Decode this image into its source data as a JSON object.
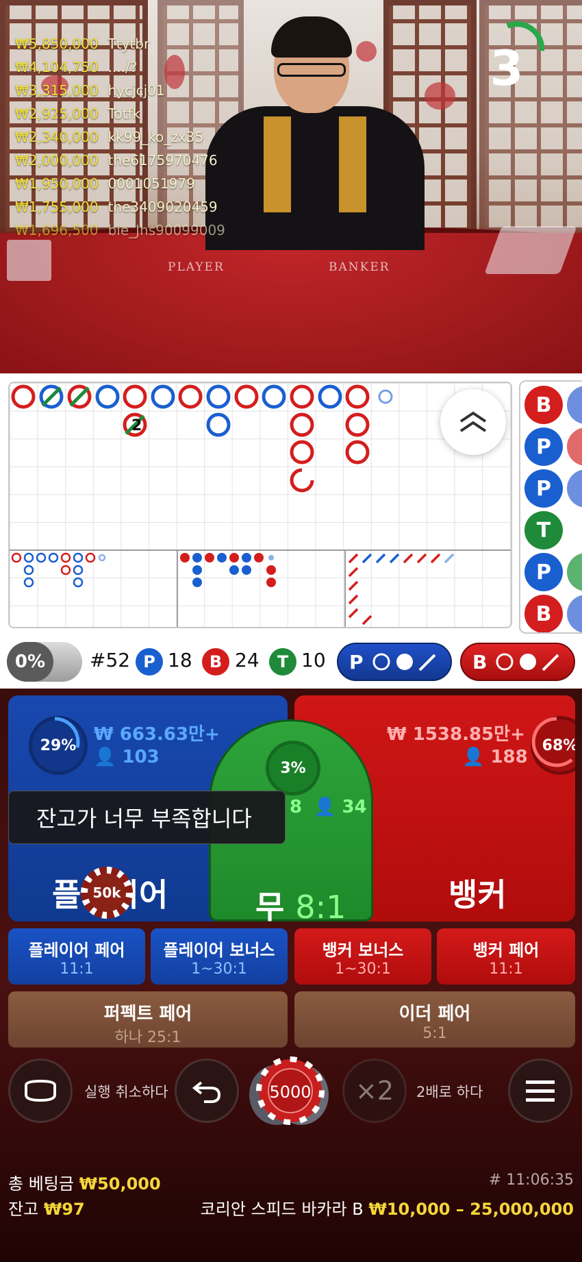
{
  "leaderboard": [
    {
      "amount": "₩5,850,000",
      "user": "Ttytbr"
    },
    {
      "amount": "₩4,104,750",
      "user": "..../?"
    },
    {
      "amount": "₩3,315,000",
      "user": "hycjcj01"
    },
    {
      "amount": "₩2,925,000",
      "user": "Totfk"
    },
    {
      "amount": "₩2,340,000",
      "user": "kk99_ko_zx35"
    },
    {
      "amount": "₩2,000,000",
      "user": "the6175970476"
    },
    {
      "amount": "₩1,950,000",
      "user": "0001051979"
    },
    {
      "amount": "₩1,755,000",
      "user": "the3409020459"
    },
    {
      "amount": "₩1,696,500",
      "user": "bie_Jhs90099009"
    }
  ],
  "timer": {
    "seconds": "3"
  },
  "table_labels": {
    "player": "PLAYER",
    "banker": "BANKER"
  },
  "roadmap": {
    "tie_badge": "2",
    "bead_labels": [
      "B",
      "P",
      "P",
      "T",
      "P",
      "B"
    ]
  },
  "stats": {
    "percent": "0%",
    "round": "#52",
    "player_label": "P",
    "player_count": "18",
    "banker_label": "B",
    "banker_count": "24",
    "tie_label": "T",
    "tie_count": "10",
    "player_predict": "P",
    "banker_predict": "B"
  },
  "colors": {
    "player": "#1a5fd0",
    "banker": "#d41e1e",
    "tie": "#1e8a3a",
    "gold": "#f4d63a"
  },
  "bets": {
    "player": {
      "percent": "29%",
      "amount": "₩ 663.63만+",
      "players": "103",
      "title": "플레이어"
    },
    "tie": {
      "percent": "3%",
      "amount_partial": "8",
      "players": "34",
      "title": "무",
      "odds": "8:1"
    },
    "banker": {
      "percent": "68%",
      "amount": "₩ 1538.85만+",
      "players": "188",
      "title": "뱅커"
    }
  },
  "toast": "잔고가 너무 부족합니다",
  "placed_chip": "50k",
  "side_bets": [
    {
      "title": "플레이어 페어",
      "odds": "11:1"
    },
    {
      "title": "플레이어 보너스",
      "odds": "1~30:1"
    },
    {
      "title": "뱅커 보너스",
      "odds": "1~30:1"
    },
    {
      "title": "뱅커 페어",
      "odds": "11:1"
    }
  ],
  "pair_bets": [
    {
      "title": "퍼펙트 페어",
      "odds": "하나 25:1"
    },
    {
      "title": "이더 페어",
      "odds": "5:1"
    }
  ],
  "controls": {
    "undo_label": "실행 취소하다",
    "chip_value": "5000",
    "double_symbol": "×2",
    "double_label": "2배로 하다"
  },
  "footer": {
    "total_bet_label": "총 베팅금",
    "total_bet_value": "₩50,000",
    "balance_label": "잔고",
    "balance_value": "₩97",
    "time": "# 11:06:35",
    "table_name": "코리안 스피드 바카라 B",
    "limits": "₩10,000 – 25,000,000"
  }
}
